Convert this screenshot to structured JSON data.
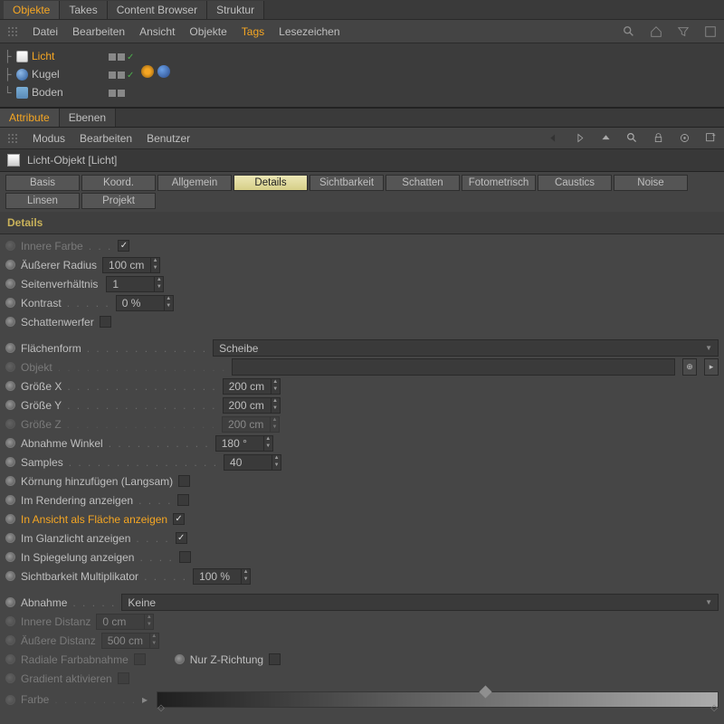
{
  "topTabs": {
    "objekte": "Objekte",
    "takes": "Takes",
    "content": "Content Browser",
    "struktur": "Struktur"
  },
  "menu1": {
    "datei": "Datei",
    "bearbeiten": "Bearbeiten",
    "ansicht": "Ansicht",
    "objekte": "Objekte",
    "tags": "Tags",
    "lesezeichen": "Lesezeichen"
  },
  "tree": {
    "licht": "Licht",
    "kugel": "Kugel",
    "boden": "Boden"
  },
  "attrTabs": {
    "attribute": "Attribute",
    "ebenen": "Ebenen"
  },
  "attrMenu": {
    "modus": "Modus",
    "bearbeiten": "Bearbeiten",
    "benutzer": "Benutzer"
  },
  "objHeader": "Licht-Objekt [Licht]",
  "subtabs": {
    "basis": "Basis",
    "koord": "Koord.",
    "allgemein": "Allgemein",
    "details": "Details",
    "sichtbarkeit": "Sichtbarkeit",
    "schatten": "Schatten",
    "fotometrisch": "Fotometrisch",
    "caustics": "Caustics",
    "noise": "Noise",
    "linsen": "Linsen",
    "projekt": "Projekt"
  },
  "sectionTitle": "Details",
  "labels": {
    "innereFarbe": "Innere Farbe",
    "aeussRadius": "Äußerer Radius",
    "seitenverh": "Seitenverhältnis",
    "kontrast": "Kontrast",
    "schattenwerfer": "Schattenwerfer",
    "flaechenform": "Flächenform",
    "objekt": "Objekt",
    "groesseX": "Größe X",
    "groesseY": "Größe Y",
    "groesseZ": "Größe Z",
    "abnahmeWinkel": "Abnahme Winkel",
    "samples": "Samples",
    "koernung": "Körnung hinzufügen (Langsam)",
    "imRendering": "Im Rendering anzeigen",
    "inAnsicht": "In Ansicht als Fläche anzeigen",
    "imGlanzlicht": "Im Glanzlicht anzeigen",
    "inSpiegelung": "In Spiegelung anzeigen",
    "sichtMult": "Sichtbarkeit Multiplikator",
    "abnahme": "Abnahme",
    "innereDist": "Innere Distanz",
    "aeussDist": "Äußere Distanz",
    "radialeFarb": "Radiale Farbabnahme",
    "nurZ": "Nur Z-Richtung",
    "gradAkt": "Gradient aktivieren",
    "farbe": "Farbe"
  },
  "values": {
    "aeussRadius": "100 cm",
    "seitenverh": "1",
    "kontrast": "0 %",
    "flaechenform": "Scheibe",
    "groesseX": "200 cm",
    "groesseY": "200 cm",
    "groesseZ": "200 cm",
    "abnahmeWinkel": "180 °",
    "samples": "40",
    "sichtMult": "100 %",
    "abnahme": "Keine",
    "innereDist": "0 cm",
    "aeussDist": "500 cm"
  }
}
